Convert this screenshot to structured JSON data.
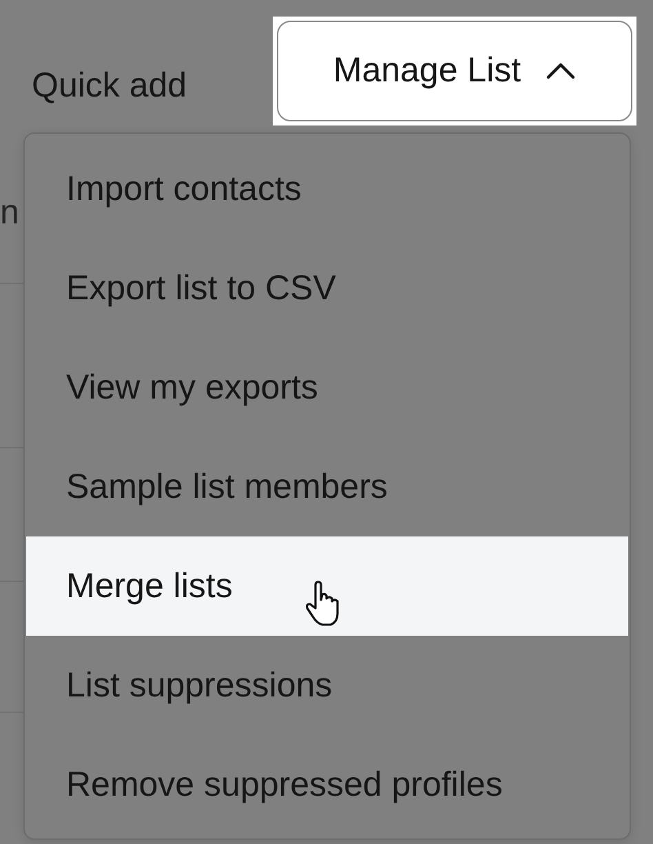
{
  "toolbar": {
    "quick_add": "Quick add",
    "manage_button": {
      "label": "Manage List",
      "expanded": true
    }
  },
  "background_text": "n",
  "menu": {
    "items": [
      {
        "label": "Import contacts",
        "selected": false
      },
      {
        "label": "Export list to CSV",
        "selected": false
      },
      {
        "label": "View my exports",
        "selected": false
      },
      {
        "label": "Sample list members",
        "selected": false
      },
      {
        "label": "Merge lists",
        "selected": true
      },
      {
        "label": "List suppressions",
        "selected": false
      },
      {
        "label": "Remove suppressed profiles",
        "selected": false
      }
    ]
  }
}
